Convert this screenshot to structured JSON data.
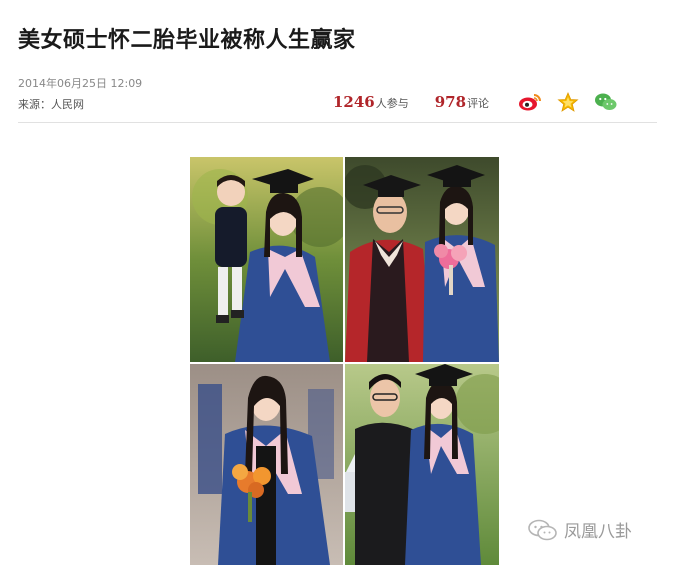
{
  "article": {
    "title": "美女硕士怀二胎毕业被称人生赢家",
    "date": "2014年06月25日  12:09",
    "source": "来源：人民网"
  },
  "stats": {
    "participants": "1246",
    "participants_label": "人参与",
    "comments": "978",
    "comments_label": "评论"
  },
  "share_icons": [
    "weibo-icon",
    "star-icon",
    "wechat-icon"
  ],
  "watermark": {
    "text": "凤凰八卦"
  },
  "colors": {
    "accent": "#b0252a",
    "robe_blue": "#2f4f95",
    "robe_red": "#b5262a"
  }
}
